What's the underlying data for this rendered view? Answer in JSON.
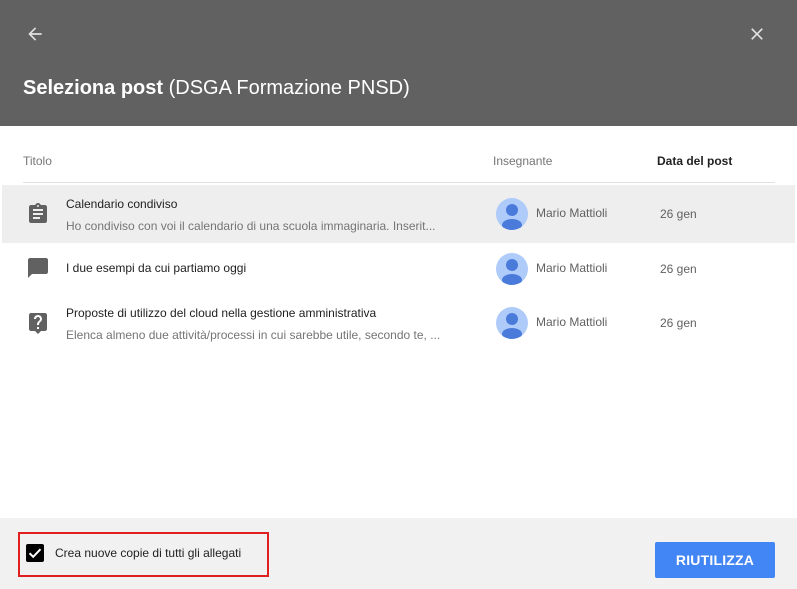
{
  "header": {
    "title_bold": "Seleziona post",
    "title_paren_open": " (",
    "title_class": "DSGA Formazione PNSD",
    "title_paren_close": ")",
    "back_icon": "arrow-back-icon",
    "close_icon": "close-icon",
    "background_color": "#616161"
  },
  "table": {
    "columns": {
      "title": "Titolo",
      "teacher": "Insegnante",
      "date": "Data del post"
    },
    "rows": [
      {
        "icon": "assignment-icon",
        "title": "Calendario condiviso",
        "description": "Ho condiviso con voi il calendario di una scuola immaginaria. Inserit...",
        "teacher": "Mario Mattioli",
        "date": "26 gen",
        "selected": true
      },
      {
        "icon": "announcement-icon",
        "title": "I due esempi da cui partiamo oggi",
        "description": "",
        "teacher": "Mario Mattioli",
        "date": "26 gen",
        "selected": false
      },
      {
        "icon": "question-icon",
        "title": "Proposte di utilizzo del cloud nella gestione amministrativa",
        "description": "Elenca almeno due attività/processi in cui sarebbe utile, secondo te, ...",
        "teacher": "Mario Mattioli",
        "date": "26 gen",
        "selected": false
      }
    ]
  },
  "footer": {
    "checkbox_label": "Crea nuove copie di tutti gli allegati",
    "checkbox_checked": true,
    "reuse_button": "RIUTILIZZA",
    "accent_color": "#4285f4",
    "highlight_color": "#e02020"
  }
}
